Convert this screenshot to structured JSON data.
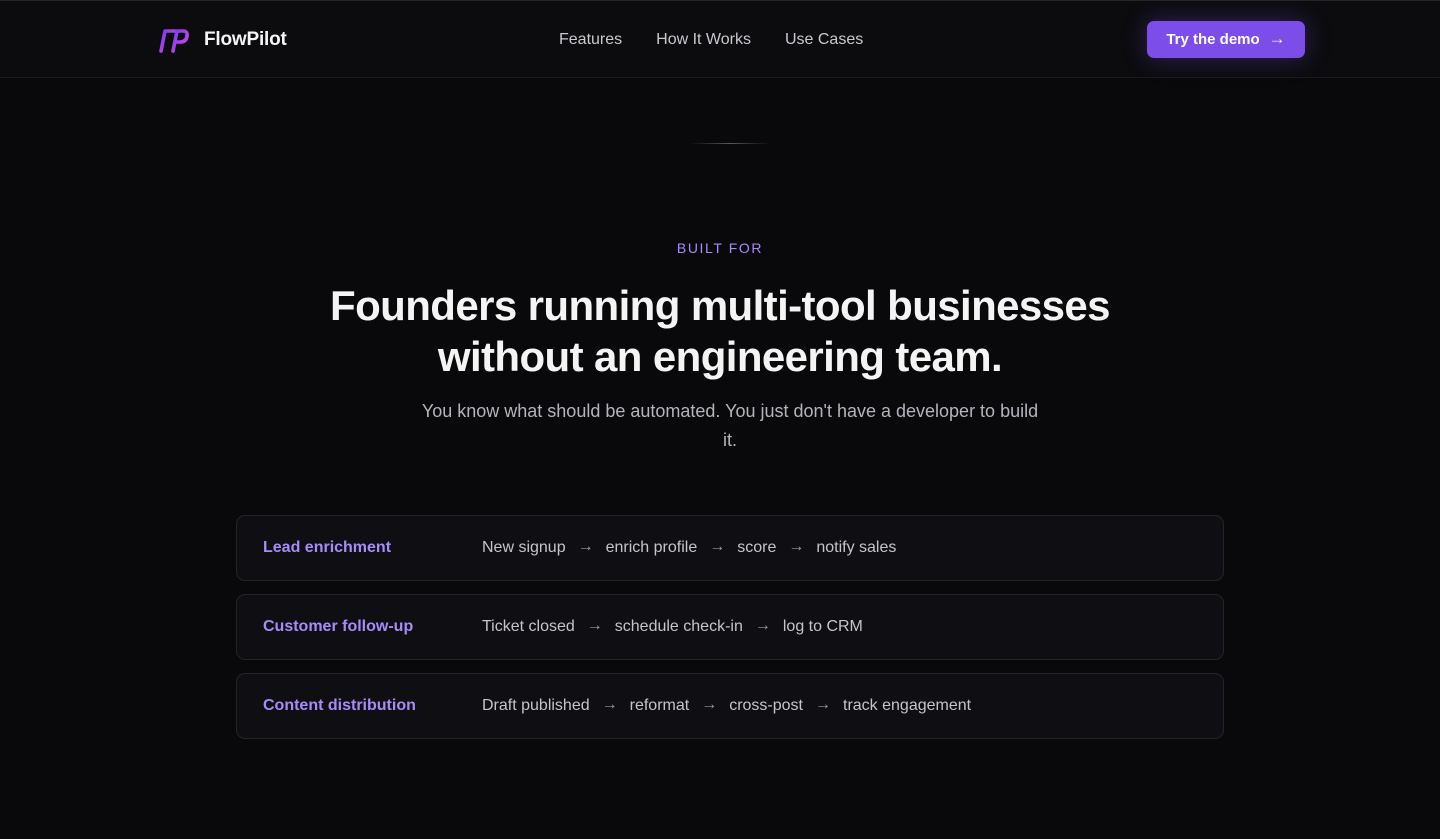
{
  "brand": {
    "name": "FlowPilot",
    "logo_icon": "fp-logo-icon",
    "accent": "#a855f7"
  },
  "nav": {
    "links": [
      {
        "label": "Features"
      },
      {
        "label": "How It Works"
      },
      {
        "label": "Use Cases"
      }
    ],
    "cta": {
      "label": "Try the demo",
      "arrow": "→",
      "color": "#7c4de8"
    }
  },
  "hero": {
    "eyebrow": "BUILT FOR",
    "headline": "Founders running multi-tool businesses without an engineering team.",
    "subhead": "You know what should be automated. You just don't have a developer to build it."
  },
  "use_cases": [
    {
      "title": "Lead enrichment",
      "steps": [
        "New signup",
        "enrich profile",
        "score",
        "notify sales"
      ]
    },
    {
      "title": "Customer follow-up",
      "steps": [
        "Ticket closed",
        "schedule check-in",
        "log to CRM"
      ]
    },
    {
      "title": "Content distribution",
      "steps": [
        "Draft published",
        "reformat",
        "cross-post",
        "track engagement"
      ]
    }
  ],
  "flow_arrow": "→",
  "colors": {
    "background": "#09090b",
    "accent_text": "#a78bfa",
    "cta_bg": "#7c4de8"
  }
}
